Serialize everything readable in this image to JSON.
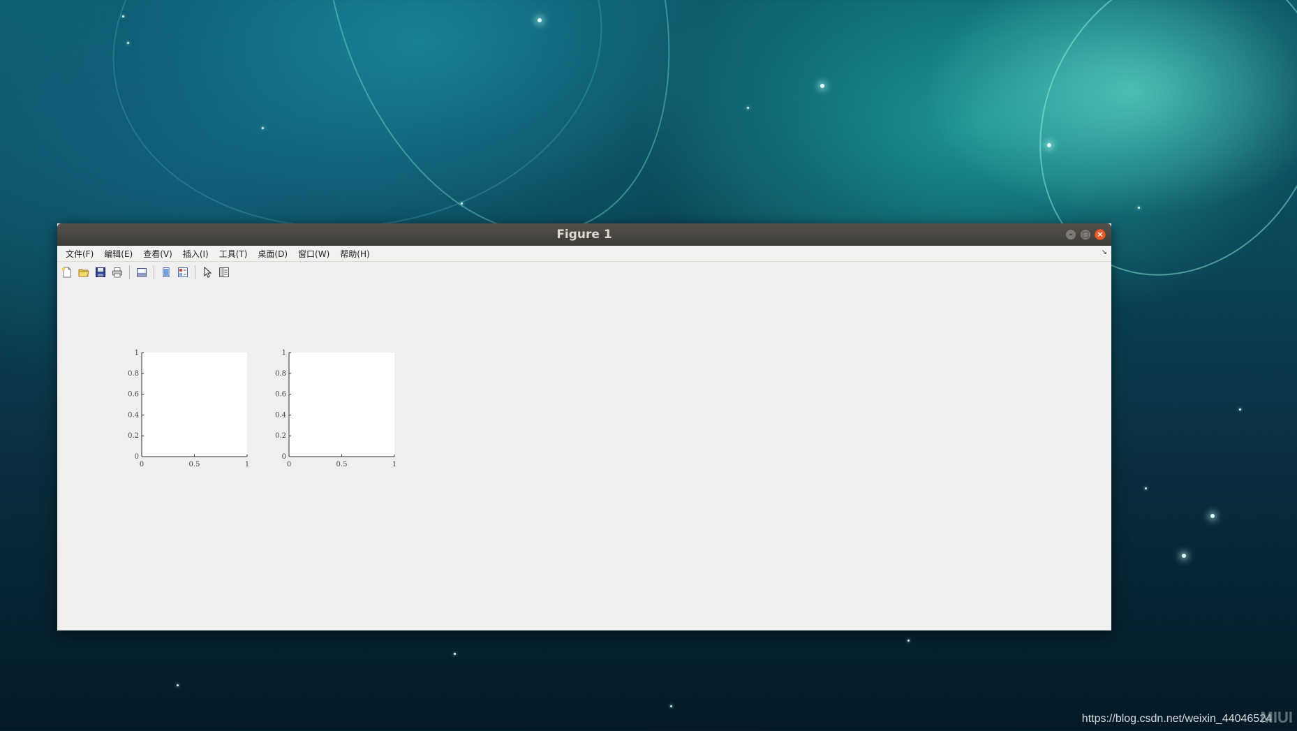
{
  "window": {
    "title": "Figure 1"
  },
  "menu": {
    "items": [
      {
        "label": "文件(F)",
        "name": "menu-file"
      },
      {
        "label": "编辑(E)",
        "name": "menu-edit"
      },
      {
        "label": "查看(V)",
        "name": "menu-view"
      },
      {
        "label": "插入(I)",
        "name": "menu-insert"
      },
      {
        "label": "工具(T)",
        "name": "menu-tools"
      },
      {
        "label": "桌面(D)",
        "name": "menu-desktop"
      },
      {
        "label": "窗口(W)",
        "name": "menu-window"
      },
      {
        "label": "帮助(H)",
        "name": "menu-help"
      }
    ]
  },
  "toolbar": {
    "icons": [
      "new-figure-icon",
      "open-file-icon",
      "save-icon",
      "print-icon",
      "print-preview-icon",
      "hide-plot-tools-icon",
      "show-plot-tools-icon",
      "edit-plot-pointer-icon",
      "property-editor-icon"
    ]
  },
  "chart_data": [
    {
      "type": "scatter",
      "series": [],
      "xlim": [
        0,
        1
      ],
      "ylim": [
        0,
        1
      ],
      "xticks": [
        "0",
        "0.5",
        "1"
      ],
      "yticks": [
        "0",
        "0.2",
        "0.4",
        "0.6",
        "0.8",
        "1"
      ],
      "grid": false
    },
    {
      "type": "scatter",
      "series": [],
      "xlim": [
        0,
        1
      ],
      "ylim": [
        0,
        1
      ],
      "xticks": [
        "0",
        "0.5",
        "1"
      ],
      "yticks": [
        "0",
        "0.2",
        "0.4",
        "0.6",
        "0.8",
        "1"
      ],
      "grid": false
    }
  ],
  "desktop": {
    "watermark": "https://blog.csdn.net/weixin_44046524",
    "logo": "MIUI"
  }
}
